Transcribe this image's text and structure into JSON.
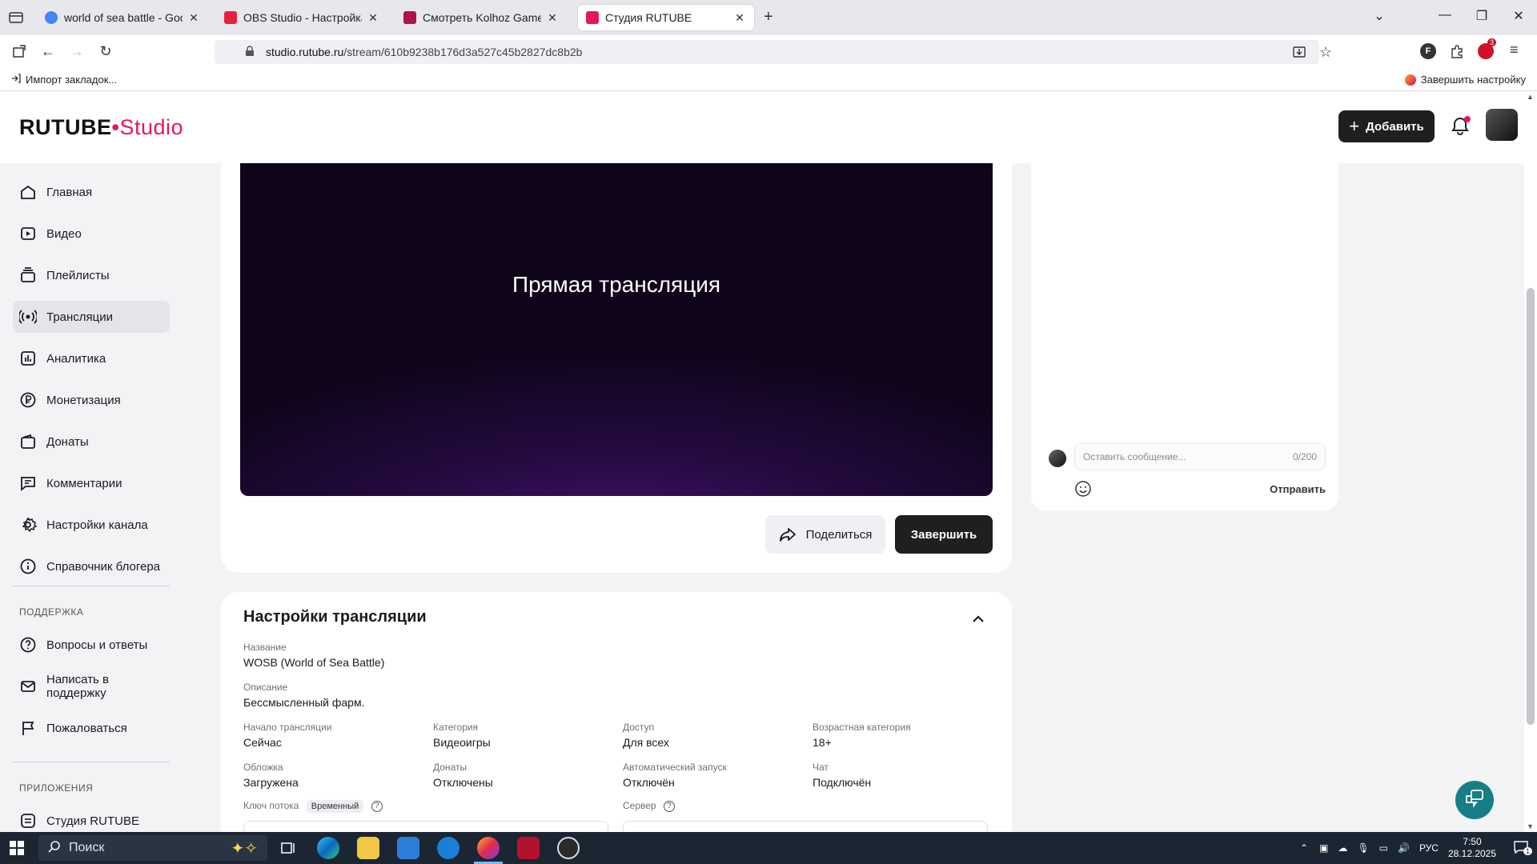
{
  "browser": {
    "tabs": [
      {
        "title": "world of sea battle - Google Se",
        "fav_color": "#4285f4"
      },
      {
        "title": "OBS Studio - Настройка Обс д",
        "fav_color": "#e3233d"
      },
      {
        "title": "Смотреть Kolhoz Games на RU",
        "fav_color": "#b0124a"
      },
      {
        "title": "Студия RUTUBE",
        "fav_color": "#e6185a"
      }
    ],
    "url_domain": "studio.rutube.ru",
    "url_path": "/stream/610b9238b176d3a527c45b2827dc8b2b",
    "bookmark_import": "Импорт закладок...",
    "finish_setup": "Завершить настройку",
    "extension_badge": "3"
  },
  "header": {
    "logo_main": "RUTUBE",
    "logo_dot": "•",
    "logo_studio": "Studio",
    "add_label": "Добавить",
    "accent": "#e6185a"
  },
  "sidebar": {
    "items": [
      {
        "label": "Главная",
        "icon": "home-icon"
      },
      {
        "label": "Видео",
        "icon": "video-icon"
      },
      {
        "label": "Плейлисты",
        "icon": "playlist-icon"
      },
      {
        "label": "Трансляции",
        "icon": "broadcast-icon",
        "active": true
      },
      {
        "label": "Аналитика",
        "icon": "analytics-icon"
      },
      {
        "label": "Монетизация",
        "icon": "ruble-icon"
      },
      {
        "label": "Донаты",
        "icon": "wallet-icon"
      },
      {
        "label": "Комментарии",
        "icon": "comment-icon"
      },
      {
        "label": "Настройки канала",
        "icon": "gear-icon"
      },
      {
        "label": "Справочник блогера",
        "icon": "info-icon"
      }
    ],
    "support_heading": "ПОДДЕРЖКА",
    "support_items": [
      {
        "label": "Вопросы и ответы",
        "icon": "question-icon"
      },
      {
        "label": "Написать в поддержку",
        "icon": "mail-icon"
      },
      {
        "label": "Пожаловаться",
        "icon": "flag-icon"
      }
    ],
    "apps_heading": "ПРИЛОЖЕНИЯ",
    "apps_items": [
      {
        "label": "Студия RUTUBE",
        "icon": "studio-icon"
      }
    ]
  },
  "player": {
    "title": "Прямая трансляция",
    "share_label": "Поделиться",
    "finish_label": "Завершить"
  },
  "chat": {
    "placeholder": "Оставить сообщение...",
    "counter": "0/200",
    "send_label": "Отправить"
  },
  "settings": {
    "title": "Настройки трансляции",
    "name_label": "Название",
    "name_value": "WOSB (World of Sea Battle)",
    "desc_label": "Описание",
    "desc_value": "Бессмысленный фарм.",
    "start_label": "Начало трансляции",
    "start_value": "Сейчас",
    "category_label": "Категория",
    "category_value": "Видеоигры",
    "access_label": "Доступ",
    "access_value": "Для всех",
    "age_label": "Возрастная категория",
    "age_value": "18+",
    "cover_label": "Обложка",
    "cover_value": "Загружена",
    "donates_label": "Донаты",
    "donates_value": "Отключены",
    "autostart_label": "Автоматический запуск",
    "autostart_value": "Отключён",
    "chat_label": "Чат",
    "chat_value": "Подключён",
    "key_label": "Ключ потока",
    "key_badge": "Временный",
    "server_label": "Сервер"
  },
  "taskbar": {
    "search_label": "Поиск",
    "lang": "РУС",
    "time": "7:50",
    "date": "28.12.2025",
    "notif_count": "1"
  }
}
